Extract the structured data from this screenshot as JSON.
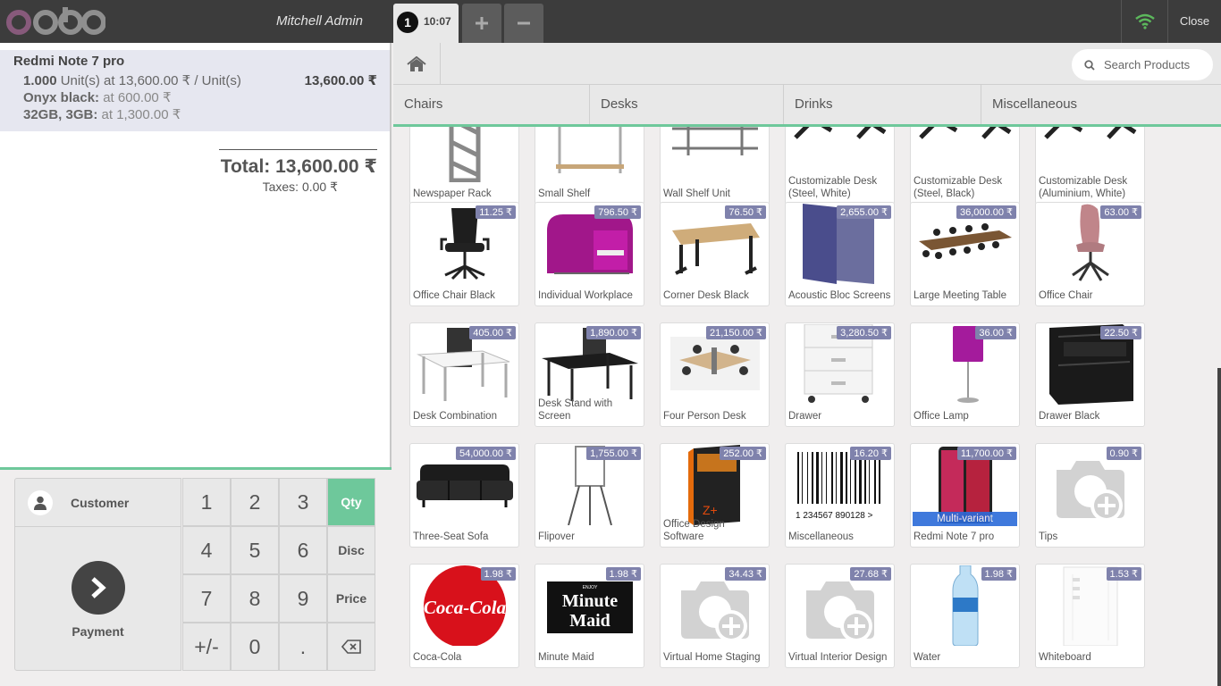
{
  "header": {
    "logo": "odoo",
    "cashier": "Mitchell Admin",
    "order_tab": {
      "number": "1",
      "time": "10:07"
    },
    "add_order_label": "+",
    "remove_order_label": "−",
    "close_label": "Close",
    "icons": [
      "wifi-icon"
    ]
  },
  "order": {
    "line": {
      "product": "Redmi Note 7 pro",
      "qty": "1.000",
      "qty_detail": " Unit(s) at 13,600.00 ₹ / Unit(s)",
      "price": "13,600.00 ₹",
      "attributes": [
        {
          "name": "Onyx black:",
          "value": " at 600.00 ₹"
        },
        {
          "name": "32GB, 3GB:",
          "value": " at 1,300.00 ₹"
        }
      ]
    },
    "total": "Total: 13,600.00 ₹",
    "taxes": "Taxes: 0.00 ₹"
  },
  "actionpad": {
    "customer": "Customer",
    "payment": "Payment"
  },
  "numpad": {
    "keys": [
      "1",
      "2",
      "3",
      "4",
      "5",
      "6",
      "7",
      "8",
      "9",
      "+/-",
      "0",
      "."
    ],
    "modes": [
      "Qty",
      "Disc",
      "Price"
    ],
    "selected_mode": "Qty",
    "backspace_icon": "backspace-icon"
  },
  "search": {
    "placeholder": "Search Products"
  },
  "categories": [
    "Chairs",
    "Desks",
    "Drinks",
    "Miscellaneous"
  ],
  "products": [
    {
      "name": "Newspaper Rack",
      "price": "",
      "icon": "rack"
    },
    {
      "name": "Small Shelf",
      "price": "",
      "icon": "shelf"
    },
    {
      "name": "Wall Shelf Unit",
      "price": "",
      "icon": "wallshelf"
    },
    {
      "name": "Customizable Desk (Steel, White)",
      "price": "",
      "icon": "desklegs"
    },
    {
      "name": "Customizable Desk (Steel, Black)",
      "price": "",
      "icon": "desklegs"
    },
    {
      "name": "Customizable Desk (Aluminium, White)",
      "price": "",
      "icon": "desklegs"
    },
    {
      "name": "Office Chair Black",
      "price": "11.25 ₹",
      "icon": "chairblack"
    },
    {
      "name": "Individual Workplace",
      "price": "796.50 ₹",
      "icon": "pod"
    },
    {
      "name": "Corner Desk Black",
      "price": "76.50 ₹",
      "icon": "desk"
    },
    {
      "name": "Acoustic Bloc Screens",
      "price": "2,655.00 ₹",
      "icon": "screens"
    },
    {
      "name": "Large Meeting Table",
      "price": "36,000.00 ₹",
      "icon": "meeting"
    },
    {
      "name": "Office Chair",
      "price": "63.00 ₹",
      "icon": "chairpink"
    },
    {
      "name": "Desk Combination",
      "price": "405.00 ₹",
      "icon": "deskcombo"
    },
    {
      "name": "Desk Stand with Screen",
      "price": "1,890.00 ₹",
      "icon": "deskstand"
    },
    {
      "name": "Four Person Desk",
      "price": "21,150.00 ₹",
      "icon": "fourdesk"
    },
    {
      "name": "Drawer",
      "price": "3,280.50 ₹",
      "icon": "drawerwhite"
    },
    {
      "name": "Office Lamp",
      "price": "36.00 ₹",
      "icon": "lamp"
    },
    {
      "name": "Drawer Black",
      "price": "22.50 ₹",
      "icon": "drawerblack"
    },
    {
      "name": "Three-Seat Sofa",
      "price": "54,000.00 ₹",
      "icon": "sofa"
    },
    {
      "name": "Flipover",
      "price": "1,755.00 ₹",
      "icon": "flipover"
    },
    {
      "name": "Office Design Software",
      "price": "252.00 ₹",
      "icon": "software"
    },
    {
      "name": "Miscellaneous",
      "price": "16.20 ₹",
      "icon": "barcode",
      "barcode": "1 234567 890128 >"
    },
    {
      "name": "Redmi Note 7 pro",
      "price": "11,700.00 ₹",
      "icon": "phone",
      "badge": "Multi-variant"
    },
    {
      "name": "Tips",
      "price": "0.90 ₹",
      "icon": "placeholder"
    },
    {
      "name": "Coca-Cola",
      "price": "1.98 ₹",
      "icon": "coke",
      "logo_text": "Coca-Cola"
    },
    {
      "name": "Minute Maid",
      "price": "1.98 ₹",
      "icon": "minutemaid",
      "logo_text": [
        "Minute",
        "Maid"
      ],
      "logo_small": "ENJOY"
    },
    {
      "name": "Virtual Home Staging",
      "price": "34.43 ₹",
      "icon": "placeholder"
    },
    {
      "name": "Virtual Interior Design",
      "price": "27.68 ₹",
      "icon": "placeholder"
    },
    {
      "name": "Water",
      "price": "1.98 ₹",
      "icon": "water"
    },
    {
      "name": "Whiteboard",
      "price": "1.53 ₹",
      "icon": "whiteboard"
    }
  ],
  "colors": {
    "topbar": "#3c3c3c",
    "accent": "#6ec89b",
    "selected_line": "#e6e7f0",
    "price_tag": "#7f82ac",
    "variant_badge": "#2b6bd9",
    "logo_purple": "#875a7b",
    "logo_gray": "#8f8f8f"
  }
}
